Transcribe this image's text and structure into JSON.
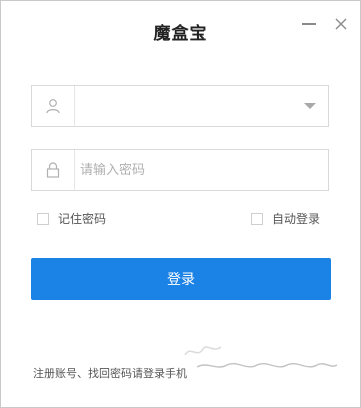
{
  "window": {
    "title": "魔盒宝"
  },
  "controls": {
    "minimize_icon": "minimize-icon",
    "close_icon": "close-icon"
  },
  "form": {
    "username": {
      "value": "",
      "placeholder": "",
      "icon": "user-icon",
      "dropdown_icon": "chevron-down-icon"
    },
    "password": {
      "value": "",
      "placeholder": "请输入密码",
      "icon": "lock-icon"
    },
    "remember_label": "记住密码",
    "auto_login_label": "自动登录",
    "login_label": "登录"
  },
  "footer": {
    "text": "注册账号、找回密码请登录手机"
  },
  "colors": {
    "accent": "#1b82e6",
    "border": "#d9d9d9"
  }
}
